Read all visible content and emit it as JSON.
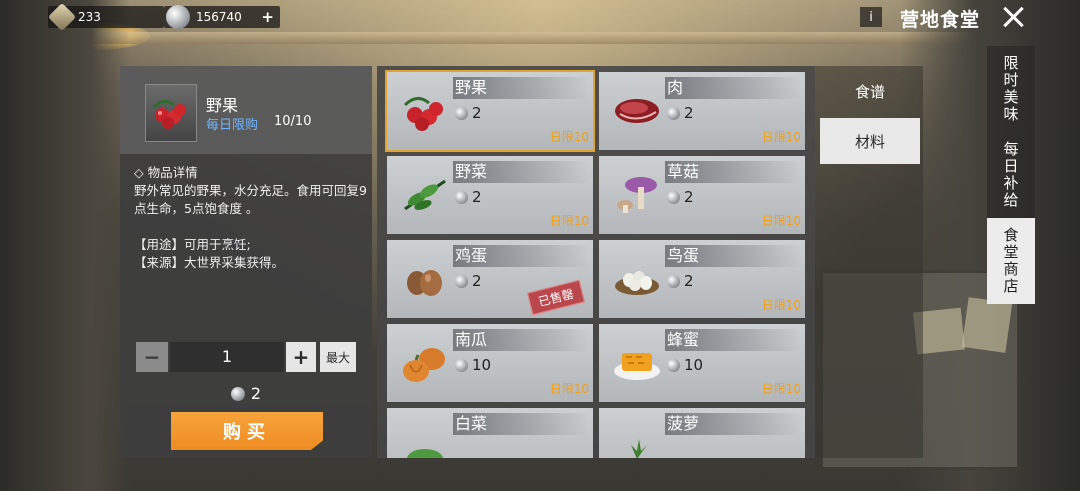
{
  "topbar": {
    "currency_1": {
      "value": "233",
      "icon": "gem-icon"
    },
    "currency_2": {
      "value": "156740",
      "icon": "silver-coin-icon",
      "plus": "+"
    },
    "info_label": "i",
    "title": "营地食堂"
  },
  "detail": {
    "name": "野果",
    "limit_label": "每日限购",
    "limit_count": "10/10",
    "section_title": "◇ 物品详情",
    "description": "野外常见的野果，水分充足。食用可回复9点生命，5点饱食度 。",
    "usage": "【用途】可用于烹饪;",
    "source": "【来源】大世界采集获得。",
    "quantity": "1",
    "minus_label": "−",
    "plus_label": "+",
    "max_label": "最大",
    "price": "2",
    "buy_label": "购买"
  },
  "items": [
    {
      "name": "野果",
      "price": "2",
      "limit": "日限10",
      "sold_out": false,
      "selected": true
    },
    {
      "name": "肉",
      "price": "2",
      "limit": "日限10",
      "sold_out": false,
      "selected": false
    },
    {
      "name": "野菜",
      "price": "2",
      "limit": "日限10",
      "sold_out": false,
      "selected": false
    },
    {
      "name": "草菇",
      "price": "2",
      "limit": "日限10",
      "sold_out": false,
      "selected": false
    },
    {
      "name": "鸡蛋",
      "price": "2",
      "limit": "",
      "sold_out": true,
      "sold_label": "已售罄",
      "selected": false
    },
    {
      "name": "鸟蛋",
      "price": "2",
      "limit": "日限10",
      "sold_out": false,
      "selected": false
    },
    {
      "name": "南瓜",
      "price": "10",
      "limit": "日限10",
      "sold_out": false,
      "selected": false
    },
    {
      "name": "蜂蜜",
      "price": "10",
      "limit": "日限10",
      "sold_out": false,
      "selected": false
    },
    {
      "name": "白菜",
      "price": "",
      "limit": "",
      "sold_out": false,
      "selected": false
    },
    {
      "name": "菠萝",
      "price": "",
      "limit": "",
      "sold_out": false,
      "selected": false
    }
  ],
  "categories": [
    {
      "label": "食谱",
      "active": false
    },
    {
      "label": "材料",
      "active": true
    }
  ],
  "side_tabs": [
    {
      "label": "限时美味",
      "active": false
    },
    {
      "label": "每日补给",
      "active": false
    },
    {
      "label": "食堂商店",
      "active": true
    }
  ],
  "colors": {
    "accent_orange": "#ee8c22",
    "limit_text": "#f2a012",
    "limit_label_blue": "#6fb5ff",
    "sold_stamp": "#b9474c"
  }
}
